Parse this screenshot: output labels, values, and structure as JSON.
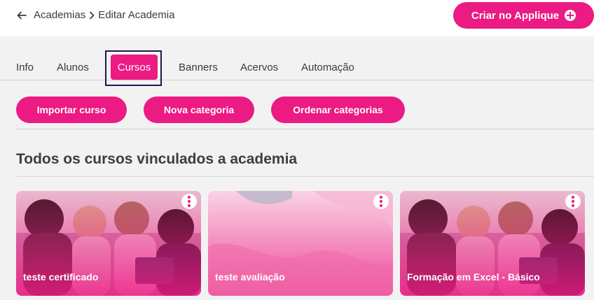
{
  "header": {
    "breadcrumb": [
      "Academias",
      "Editar Academia"
    ],
    "create_button": "Criar no Applique"
  },
  "tabs": [
    {
      "label": "Info"
    },
    {
      "label": "Alunos"
    },
    {
      "label": "Cursos",
      "active": true
    },
    {
      "label": "Banners"
    },
    {
      "label": "Acervos"
    },
    {
      "label": "Automação"
    }
  ],
  "actions": {
    "import_course": "Importar curso",
    "new_category": "Nova categoria",
    "order_categories": "Ordenar categorias"
  },
  "section": {
    "title": "Todos os cursos vinculados a academia"
  },
  "courses": [
    {
      "title": "teste certificado",
      "thumbnail": "group-photo"
    },
    {
      "title": "teste avaliação",
      "thumbnail": "pink-abstract"
    },
    {
      "title": "Formação em Excel - Básico",
      "thumbnail": "group-photo"
    }
  ],
  "colors": {
    "accent": "#ec1a83",
    "focus_ring": "#1b1a4a",
    "background": "#f3f2f3"
  }
}
